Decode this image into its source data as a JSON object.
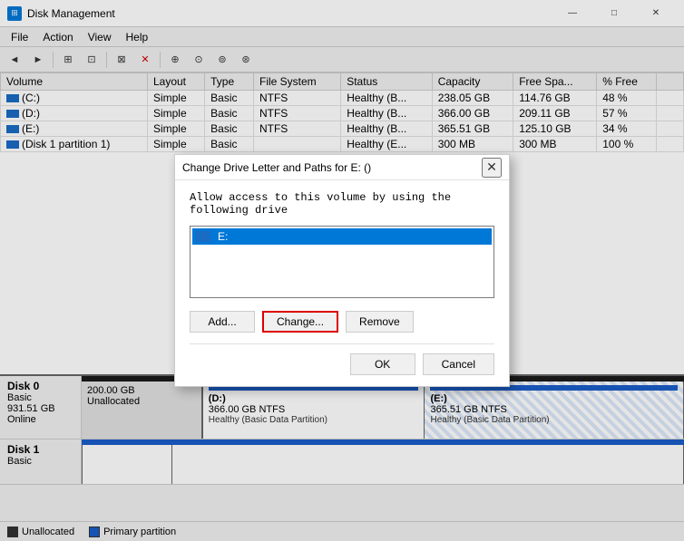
{
  "app": {
    "title": "Disk Management",
    "title_icon": "🖥",
    "controls": {
      "minimize": "—",
      "maximize": "□",
      "close": "✕"
    }
  },
  "menu": {
    "items": [
      "File",
      "Action",
      "View",
      "Help"
    ]
  },
  "toolbar": {
    "buttons": [
      "◄",
      "►",
      "⊞",
      "⊡",
      "⊠",
      "✕",
      "⊕",
      "⊙",
      "⊚",
      "⊛"
    ]
  },
  "table": {
    "columns": [
      "Volume",
      "Layout",
      "Type",
      "File System",
      "Status",
      "Capacity",
      "Free Spa...",
      "% Free",
      ""
    ],
    "rows": [
      {
        "icon": true,
        "volume": "(C:)",
        "layout": "Simple",
        "type": "Basic",
        "fs": "NTFS",
        "status": "Healthy (B...",
        "capacity": "238.05 GB",
        "free": "114.76 GB",
        "pct": "48 %"
      },
      {
        "icon": true,
        "volume": "(D:)",
        "layout": "Simple",
        "type": "Basic",
        "fs": "NTFS",
        "status": "Healthy (B...",
        "capacity": "366.00 GB",
        "free": "209.11 GB",
        "pct": "57 %"
      },
      {
        "icon": true,
        "volume": "(E:)",
        "layout": "Simple",
        "type": "Basic",
        "fs": "NTFS",
        "status": "Healthy (B...",
        "capacity": "365.51 GB",
        "free": "125.10 GB",
        "pct": "34 %"
      },
      {
        "icon": true,
        "volume": "(Disk 1 partition 1)",
        "layout": "Simple",
        "type": "Basic",
        "fs": "",
        "status": "Healthy (E...",
        "capacity": "300 MB",
        "free": "300 MB",
        "pct": "100 %"
      }
    ]
  },
  "dialog": {
    "title": "Change Drive Letter and Paths for E: ()",
    "close": "✕",
    "description": "Allow access to this volume by using the following drive",
    "listbox_item": "E:",
    "buttons": {
      "add": "Add...",
      "change": "Change...",
      "remove": "Remove"
    },
    "ok": "OK",
    "cancel": "Cancel"
  },
  "disks": [
    {
      "name": "Disk 0",
      "type": "Basic",
      "size": "931.51 GB",
      "status": "Online",
      "partitions": [
        {
          "type": "unalloc",
          "size": "200.00 GB",
          "label": "Unallocated",
          "header": "dark",
          "width": "20%"
        },
        {
          "type": "basic",
          "name": "(D:)",
          "size": "366.00 GB NTFS",
          "status": "Healthy (Basic Data Partition)",
          "header": "blue",
          "width": "38%"
        },
        {
          "type": "basic",
          "name": "(E:)",
          "size": "365.51 GB NTFS",
          "status": "Healthy (Basic Data Partition)",
          "header": "blue",
          "width": "42%",
          "hatched": true
        }
      ]
    },
    {
      "name": "Disk 1",
      "type": "Basic",
      "size": "",
      "status": "",
      "partitions": [
        {
          "type": "basic",
          "header": "blue",
          "width": "15%"
        },
        {
          "type": "basic",
          "header": "blue",
          "width": "85%"
        }
      ]
    }
  ],
  "legend": [
    {
      "label": "Unallocated",
      "color": "dark"
    },
    {
      "label": "Primary partition",
      "color": "blue"
    }
  ]
}
